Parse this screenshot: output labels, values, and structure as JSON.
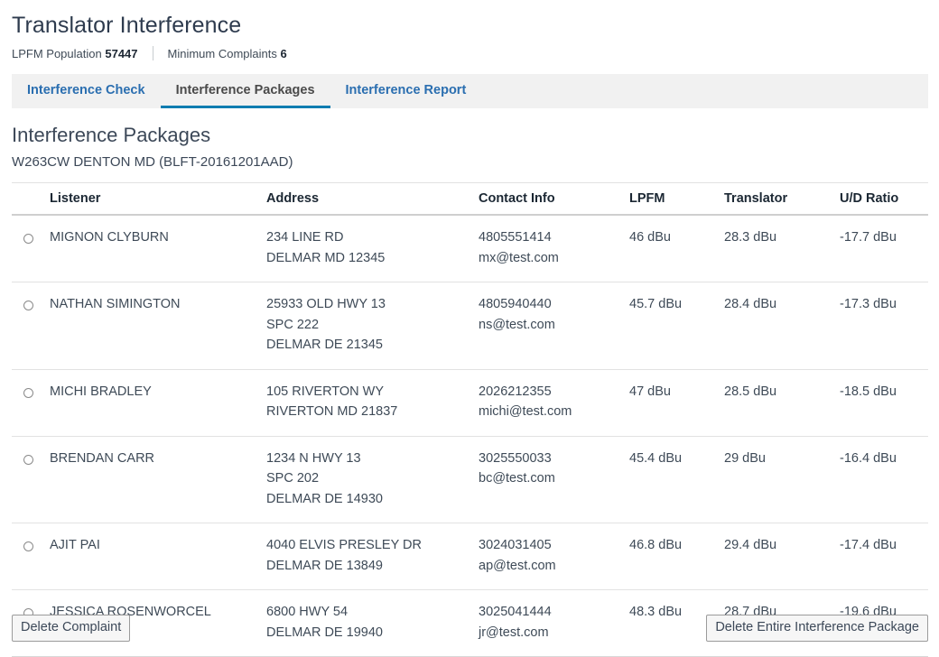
{
  "header": {
    "title": "Translator Interference",
    "meta": [
      {
        "label": "LPFM Population",
        "value": "57447"
      },
      {
        "label": "Minimum Complaints",
        "value": "6"
      }
    ]
  },
  "tabs": [
    {
      "label": "Interference Check",
      "active": false
    },
    {
      "label": "Interference Packages",
      "active": true
    },
    {
      "label": "Interference Report",
      "active": false
    }
  ],
  "section": {
    "title": "Interference Packages",
    "subtitle": "W263CW DENTON MD (BLFT-20161201AAD)"
  },
  "table": {
    "columns": [
      "",
      "Listener",
      "Address",
      "Contact Info",
      "LPFM",
      "Translator",
      "U/D Ratio"
    ],
    "rows": [
      {
        "listener": "MIGNON CLYBURN",
        "address": [
          "234 LINE RD",
          "DELMAR MD 12345"
        ],
        "phone": "4805551414",
        "email": "mx@test.com",
        "lpfm": "46 dBu",
        "translator": "28.3 dBu",
        "ud_ratio": "-17.7 dBu"
      },
      {
        "listener": "NATHAN SIMINGTON",
        "address": [
          "25933 OLD HWY 13",
          "SPC 222",
          "DELMAR DE 21345"
        ],
        "phone": "4805940440",
        "email": "ns@test.com",
        "lpfm": "45.7 dBu",
        "translator": "28.4 dBu",
        "ud_ratio": "-17.3 dBu"
      },
      {
        "listener": "MICHI BRADLEY",
        "address": [
          "105 RIVERTON WY",
          "RIVERTON MD 21837"
        ],
        "phone": "2026212355",
        "email": "michi@test.com",
        "lpfm": "47 dBu",
        "translator": "28.5 dBu",
        "ud_ratio": "-18.5 dBu"
      },
      {
        "listener": "BRENDAN CARR",
        "address": [
          "1234 N HWY 13",
          "SPC 202",
          "DELMAR DE 14930"
        ],
        "phone": "3025550033",
        "email": "bc@test.com",
        "lpfm": "45.4 dBu",
        "translator": "29 dBu",
        "ud_ratio": "-16.4 dBu"
      },
      {
        "listener": "AJIT PAI",
        "address": [
          "4040 ELVIS PRESLEY DR",
          "DELMAR DE 13849"
        ],
        "phone": "3024031405",
        "email": "ap@test.com",
        "lpfm": "46.8 dBu",
        "translator": "29.4 dBu",
        "ud_ratio": "-17.4 dBu"
      },
      {
        "listener": "JESSICA ROSENWORCEL",
        "address": [
          "6800 HWY 54",
          "DELMAR DE 19940"
        ],
        "phone": "3025041444",
        "email": "jr@test.com",
        "lpfm": "48.3 dBu",
        "translator": "28.7 dBu",
        "ud_ratio": "-19.6 dBu"
      }
    ]
  },
  "footer": {
    "delete_complaint_label": "Delete Complaint",
    "delete_package_label": "Delete Entire Interference Package"
  },
  "colors": {
    "tab_link": "#2a6eb0",
    "tab_active_underline": "#0a7cb0",
    "tabbar_bg": "#f1f1f1",
    "title": "#2e3b4e",
    "text": "#3e4a57"
  }
}
